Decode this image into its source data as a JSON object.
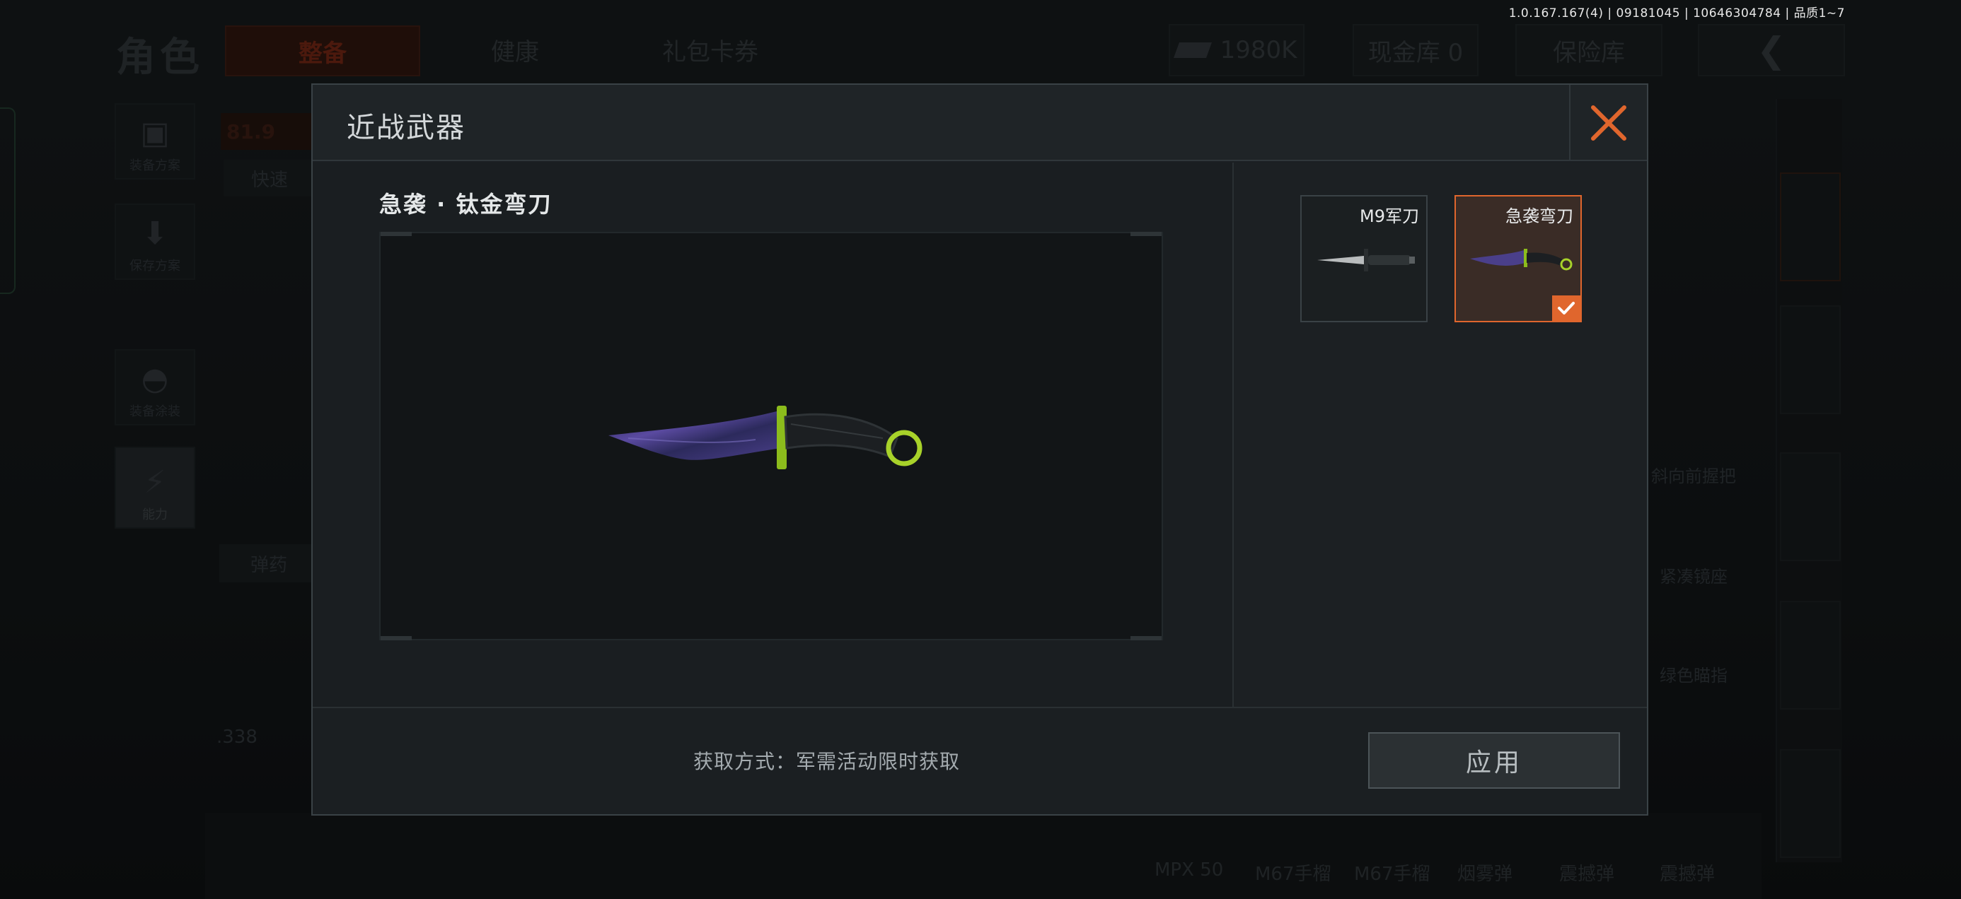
{
  "version_info": "1.0.167.167(4) | 09181045 | 10646304784 | 品质1~7",
  "background": {
    "page_title": "角色",
    "tabs": [
      "整备",
      "健康",
      "礼包卡券"
    ],
    "currency": "1980K",
    "cash_vault": "现金库 0",
    "insurance": "保险库",
    "sidebar": [
      "装备方案",
      "保存方案",
      "装备涂装",
      "能力"
    ],
    "fragments": {
      "value": "81.9",
      "quick": "快速",
      "ammo": "弹药",
      "caliber": ".338",
      "grip": "斜向前握把",
      "mount": "紧凑镜座",
      "mount2": "绿色瞄指"
    },
    "bottom_items": [
      "MPX 50",
      "M67手榴",
      "M67手榴",
      "烟雾弹",
      "震撼弹",
      "震撼弹"
    ]
  },
  "modal": {
    "title": "近战武器",
    "selected_item_name": "急袭 · 钛金弯刀",
    "acquire_text": "获取方式：军需活动限时获取",
    "apply_label": "应用",
    "items": [
      {
        "label": "M9军刀",
        "selected": false
      },
      {
        "label": "急袭弯刀",
        "selected": true
      }
    ]
  },
  "colors": {
    "accent": "#e0662d",
    "modal_bg": "#1b1f22",
    "lime": "#a8d22a",
    "blade_purple": "#4a3f8a"
  },
  "icons": [
    "close-icon",
    "checkmark-icon",
    "back-arrow-icon",
    "cash-icon",
    "armor-icon",
    "save-icon",
    "helmet-icon",
    "lightning-icon"
  ]
}
